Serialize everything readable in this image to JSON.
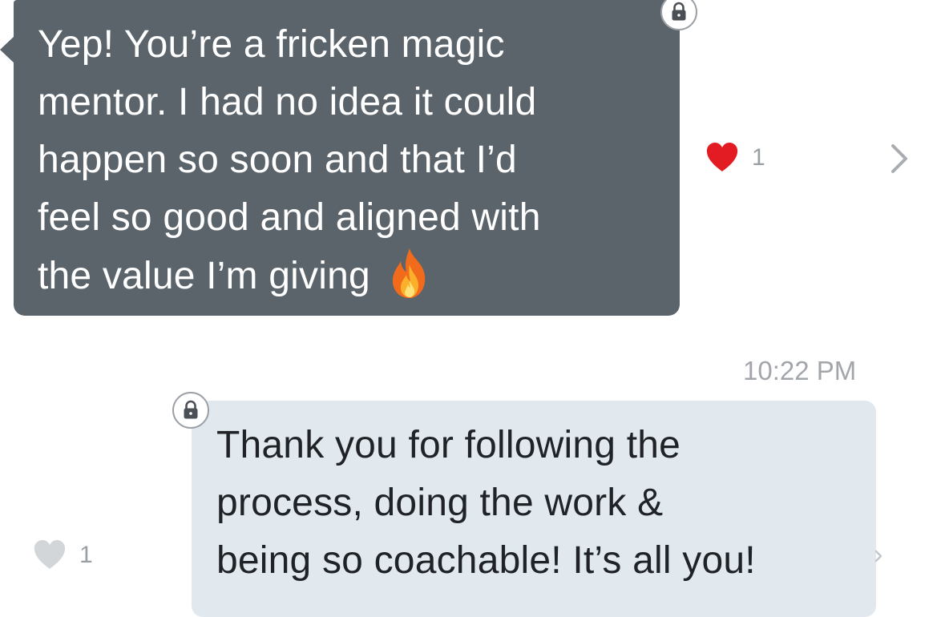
{
  "messages": [
    {
      "direction": "incoming",
      "lines": [
        "Yep! You’re a fricken magic",
        "mentor. I had no idea it could",
        "happen so soon and that I’d",
        "feel so good and aligned with",
        "the value I’m giving"
      ],
      "trailing_emoji": "fire",
      "reaction": {
        "icon": "heart-filled-red",
        "count": "1"
      }
    },
    {
      "direction": "outgoing",
      "timestamp": "10:22 PM",
      "lines": [
        "Thank you for following the",
        "process, doing the work &",
        "being so coachable! It’s all you!"
      ],
      "reaction": {
        "icon": "heart-outline-gray",
        "count": "1"
      }
    }
  ],
  "colors": {
    "incoming_bubble": "#5b646b",
    "outgoing_bubble": "#e1e8ee",
    "reaction_heart": "#e31b23",
    "muted_text": "#9a9fa3"
  }
}
